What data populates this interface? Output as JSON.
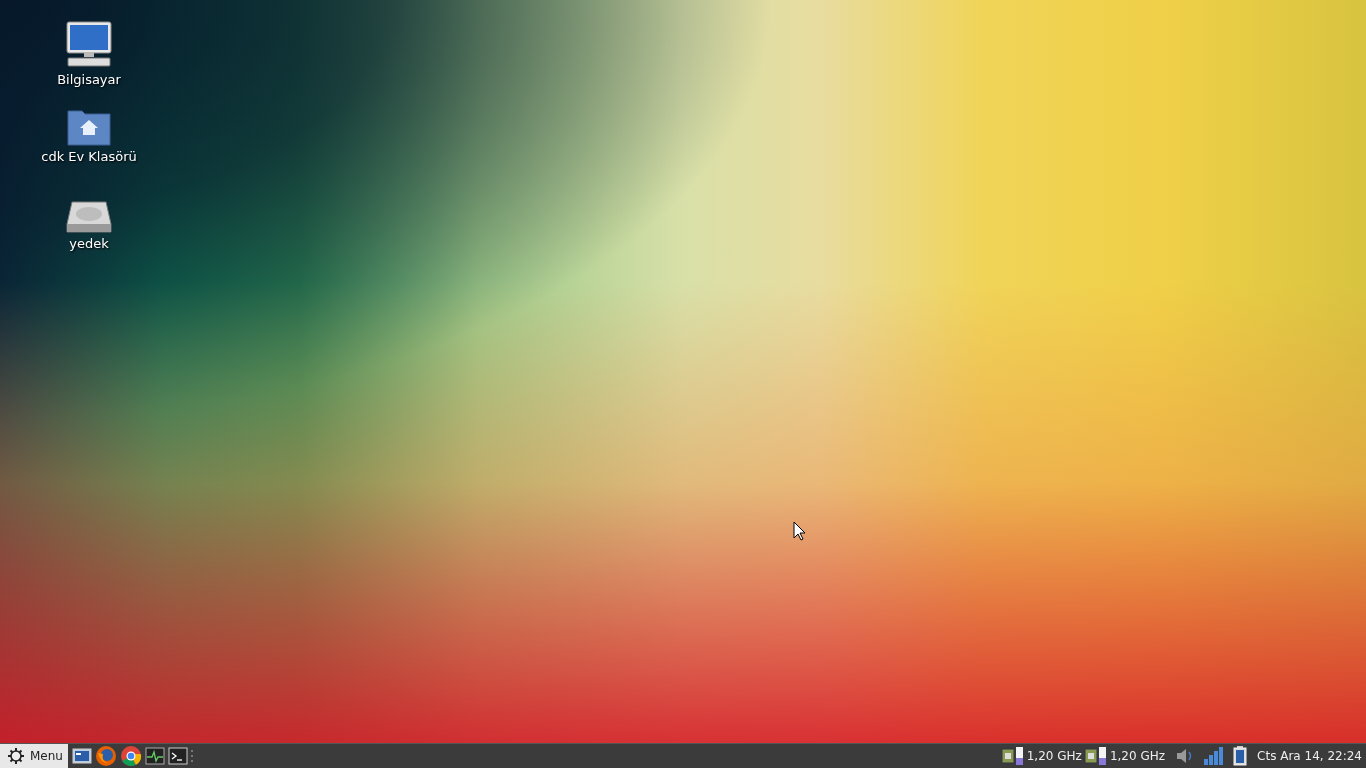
{
  "desktop_icons": [
    {
      "label": "Bilgisayar",
      "kind": "computer"
    },
    {
      "label": "cdk Ev Klasörü",
      "kind": "home"
    },
    {
      "label": "yedek",
      "kind": "drive"
    }
  ],
  "taskbar": {
    "menu_label": "Menu",
    "cpu_monitors": [
      {
        "reading": "1,20 GHz",
        "level": 0.4
      },
      {
        "reading": "1,20 GHz",
        "level": 0.4
      }
    ],
    "clock": "Cts Ara 14, 22:24"
  }
}
